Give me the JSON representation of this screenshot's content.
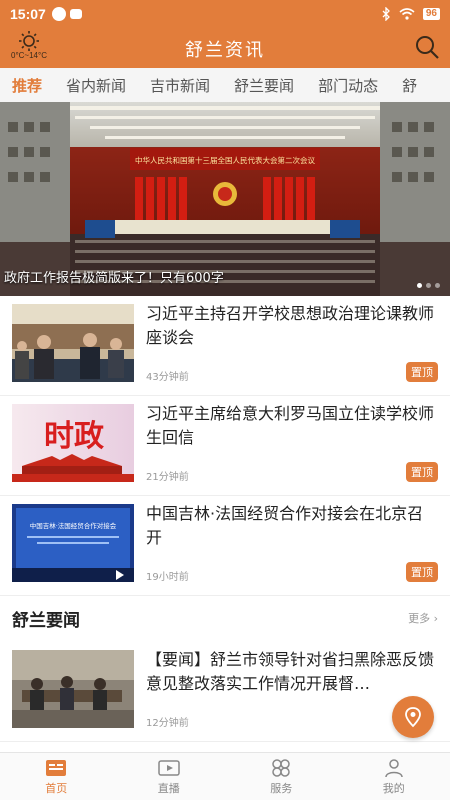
{
  "status_bar": {
    "time": "15:07",
    "battery": "96"
  },
  "header": {
    "title": "舒兰资讯",
    "weather_temp": "0°C~14°C"
  },
  "tabs": [
    {
      "label": "推荐",
      "active": true
    },
    {
      "label": "省内新闻"
    },
    {
      "label": "吉市新闻"
    },
    {
      "label": "舒兰要闻"
    },
    {
      "label": "部门动态"
    },
    {
      "label": "舒"
    }
  ],
  "banner": {
    "caption": "政府工作报告极简版来了！只有600字",
    "screen_text": "中华人民共和国第十三届全国人民代表大会第二次会议"
  },
  "news": [
    {
      "title": "习近平主持召开学校思想政治理论课教师座谈会",
      "time": "43分钟前",
      "badge": "置顶"
    },
    {
      "title": "习近平主席给意大利罗马国立住读学校师生回信",
      "time": "21分钟前",
      "badge": "置顶",
      "thumb_text": "时政"
    },
    {
      "title": "中国吉林·法国经贸合作对接会在北京召开",
      "time": "19小时前",
      "badge": "置顶",
      "thumb_text": "中国吉林·法国经贸合作对接会"
    }
  ],
  "section": {
    "title": "舒兰要闻",
    "more": "更多"
  },
  "section_news": [
    {
      "title": "【要闻】舒兰市领导针对省扫黑除恶反馈意见整改落实工作情况开展督…",
      "time": "12分钟前"
    }
  ],
  "bottom_nav": [
    {
      "label": "首页",
      "active": true
    },
    {
      "label": "直播"
    },
    {
      "label": "服务"
    },
    {
      "label": "我的"
    }
  ],
  "colors": {
    "accent": "#e27d3b"
  }
}
